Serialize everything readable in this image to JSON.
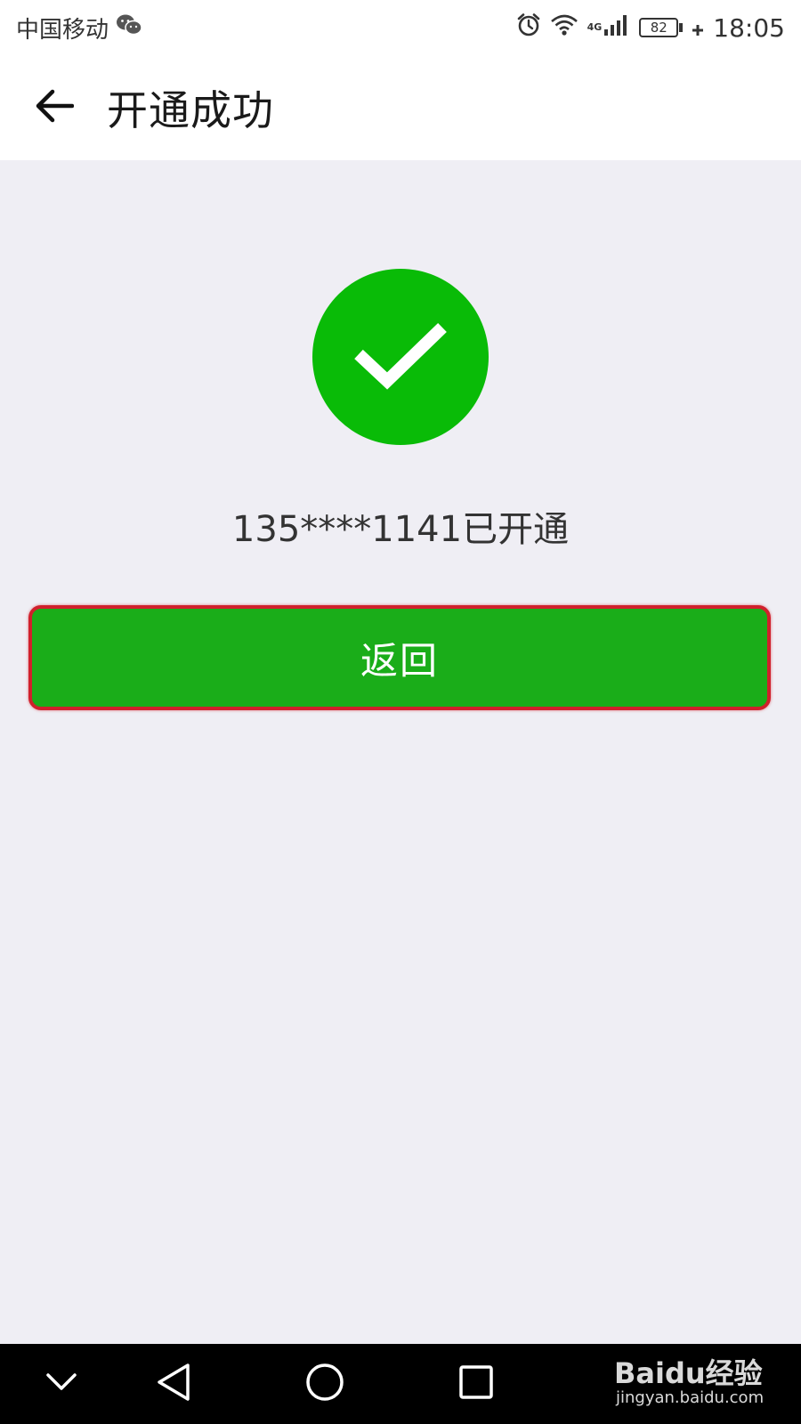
{
  "status_bar": {
    "carrier": "中国移动",
    "network": "4G",
    "battery": "82",
    "time": "18:05"
  },
  "header": {
    "title": "开通成功"
  },
  "main": {
    "message": "135****1141已开通",
    "return_label": "返回"
  },
  "watermark": {
    "logo": "Baidu经验",
    "url": "jingyan.baidu.com"
  },
  "colors": {
    "success_green": "#09bb07",
    "button_green": "#1aad19",
    "highlight_red": "#d0202c",
    "background": "#efeef4"
  },
  "icons": {
    "back": "arrow-left-icon",
    "success": "checkmark-icon",
    "nav": [
      "chevron-down-icon",
      "triangle-back-icon",
      "circle-home-icon",
      "square-recents-icon"
    ]
  }
}
